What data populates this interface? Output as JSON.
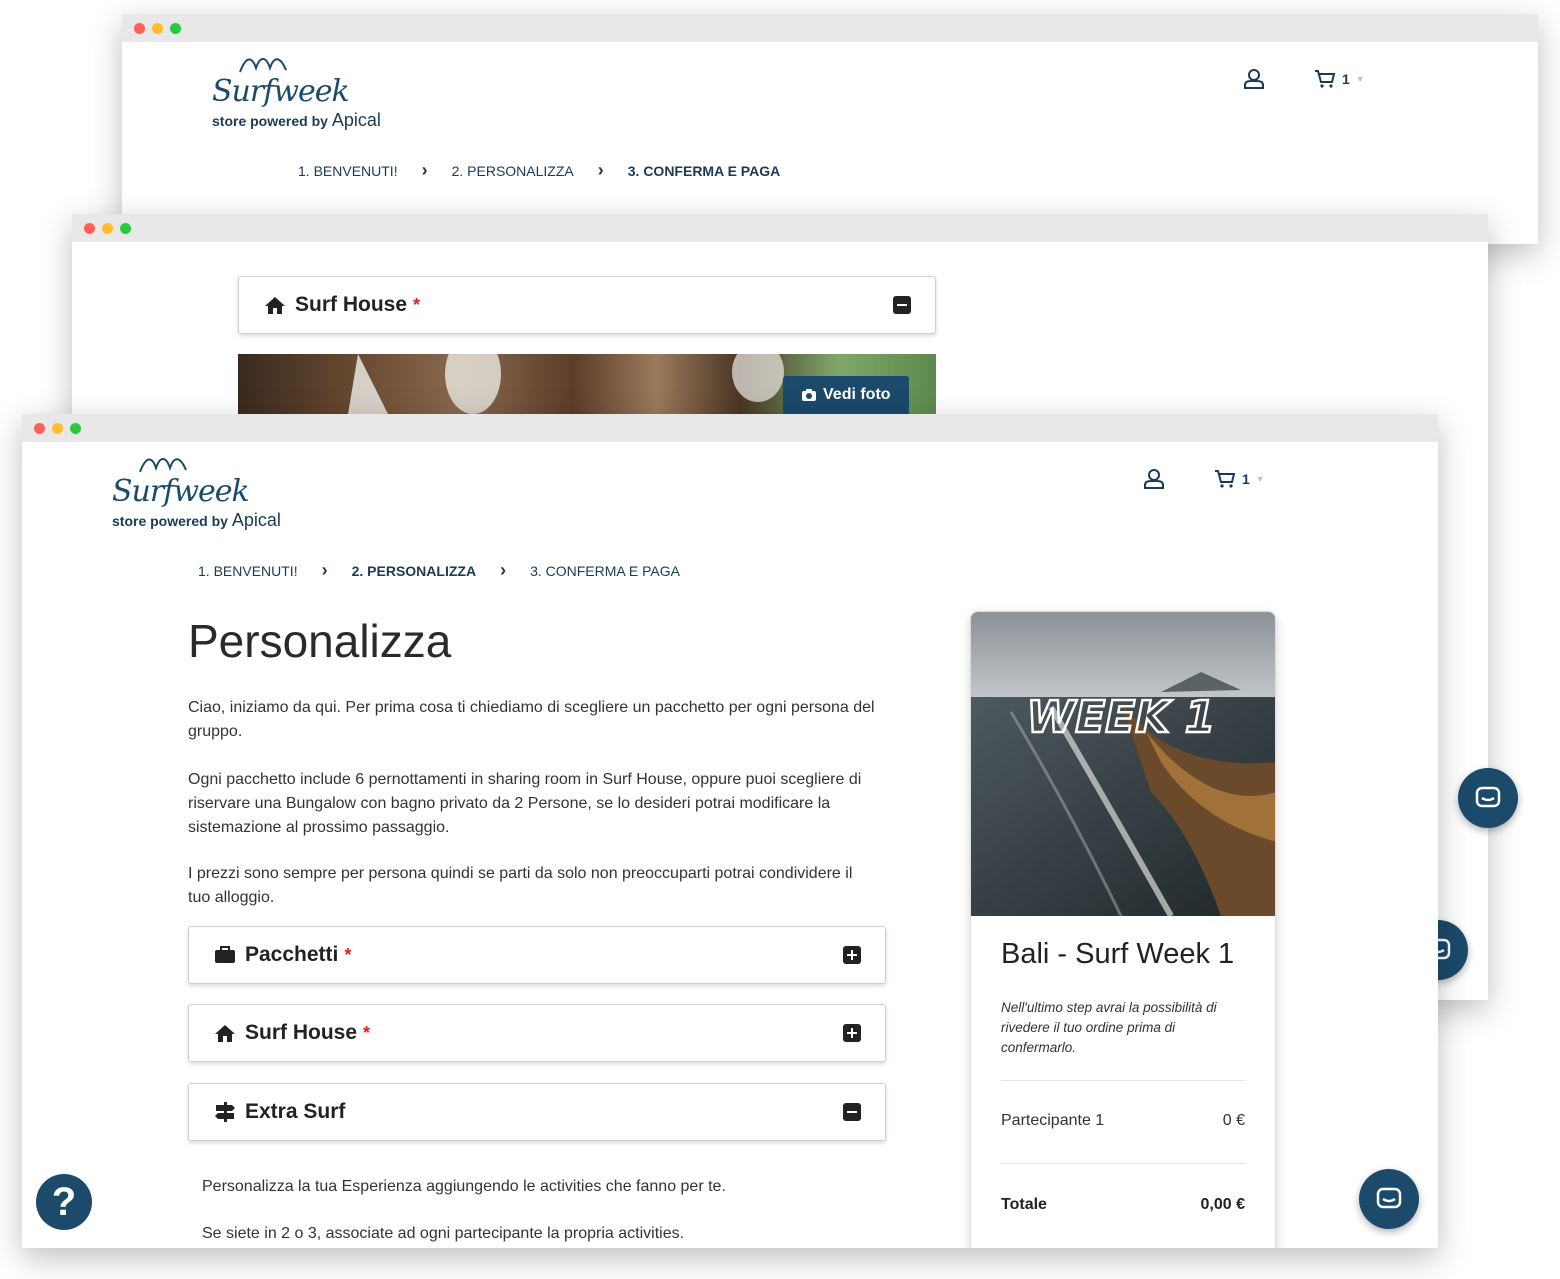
{
  "brand": {
    "script_name": "Surfweek",
    "powered_prefix": "store powered by",
    "powered_brand": "Apical"
  },
  "header": {
    "cart_count": "1"
  },
  "steps": {
    "step1": "1. BENVENUTI!",
    "step2": "2. PERSONALIZZA",
    "step3": "3. CONFERMA E PAGA"
  },
  "back_window": {
    "panel_title": "Surf House",
    "photo_button": "Vedi foto"
  },
  "main": {
    "title": "Personalizza",
    "paragraph1": "Ciao, iniziamo da qui. Per prima cosa ti chiediamo di scegliere un pacchetto per ogni persona del gruppo.",
    "paragraph2": "Ogni pacchetto include 6 pernottamenti in sharing room in Surf House, oppure puoi scegliere di riservare una Bungalow con bagno privato da 2 Persone, se lo desideri potrai modificare la sistemazione al prossimo passaggio.",
    "paragraph3": "I prezzi sono sempre per persona quindi se parti da solo non preoccuparti potrai condividere il tuo alloggio.",
    "panels": [
      {
        "title": "Pacchetti",
        "required": "*"
      },
      {
        "title": "Surf House",
        "required": "*"
      },
      {
        "title": "Extra Surf",
        "required": ""
      }
    ],
    "extra_text1": "Personalizza la tua Esperienza aggiungendo le activities che fanno per te.",
    "extra_text2": "Se siete in 2 o 3, associate ad ogni partecipante la propria activities."
  },
  "summary": {
    "image_text": "WEEK 1",
    "title": "Bali - Surf Week 1",
    "note": "Nell'ultimo step avrai la possibilità di rivedere il tuo ordine prima di confermarlo.",
    "participant_label": "Partecipante 1",
    "participant_price": "0 €",
    "total_label": "Totale",
    "total_value": "0,00 €"
  },
  "help_label": "?",
  "colors": {
    "brand_navy": "#1b4a6b",
    "required_red": "#e02020"
  }
}
